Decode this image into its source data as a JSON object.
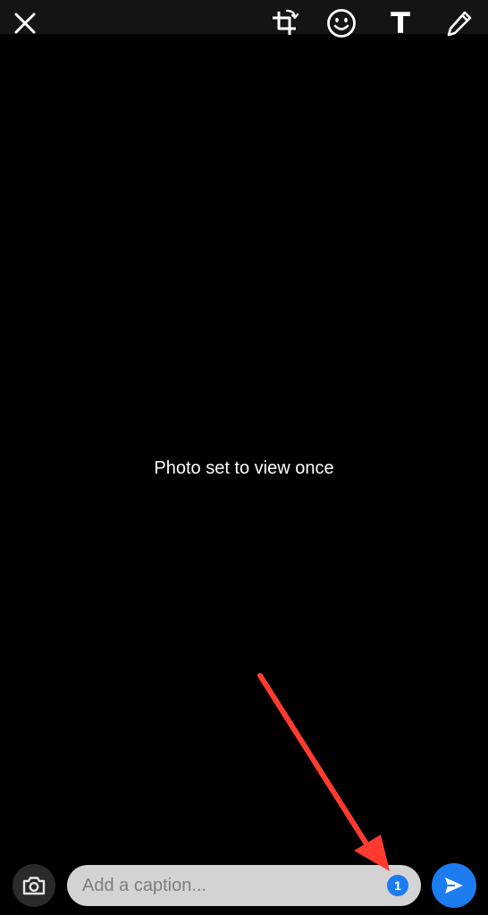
{
  "toolbar": {
    "close_icon": "close-icon",
    "crop_icon": "crop-rotate-icon",
    "emoji_icon": "emoji-icon",
    "text_icon_glyph": "T",
    "draw_icon": "pencil-icon"
  },
  "main": {
    "message": "Photo set to view once"
  },
  "compose": {
    "camera_icon": "camera-icon",
    "caption_placeholder": "Add a caption...",
    "caption_value": "",
    "view_once_badge": "1",
    "send_icon": "send-icon"
  },
  "annotation": {
    "type": "red-arrow",
    "color": "#ff3b30",
    "points_to": "view-once-badge"
  },
  "colors": {
    "background": "#000000",
    "accent": "#1c7cf0",
    "caption_field": "#d3d3d3"
  }
}
